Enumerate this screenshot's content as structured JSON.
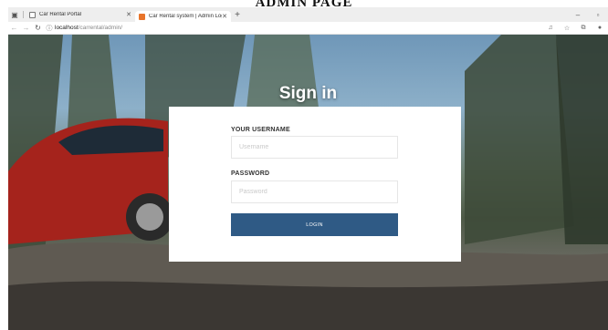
{
  "caption": "ADMIN PAGE",
  "browser": {
    "tabs": [
      {
        "label": "Car Rental Portal"
      },
      {
        "label": "Car Rental system | Admin Login"
      }
    ],
    "url_host": "localhost",
    "url_path": "/carrental/admin/"
  },
  "page": {
    "title": "Sign in",
    "username_label": "YOUR USERNAME",
    "username_placeholder": "Username",
    "password_label": "PASSWORD",
    "password_placeholder": "Password",
    "login_label": "LOGIN"
  },
  "colors": {
    "button": "#2f5a85",
    "tab_favicon": "#e8742a"
  }
}
